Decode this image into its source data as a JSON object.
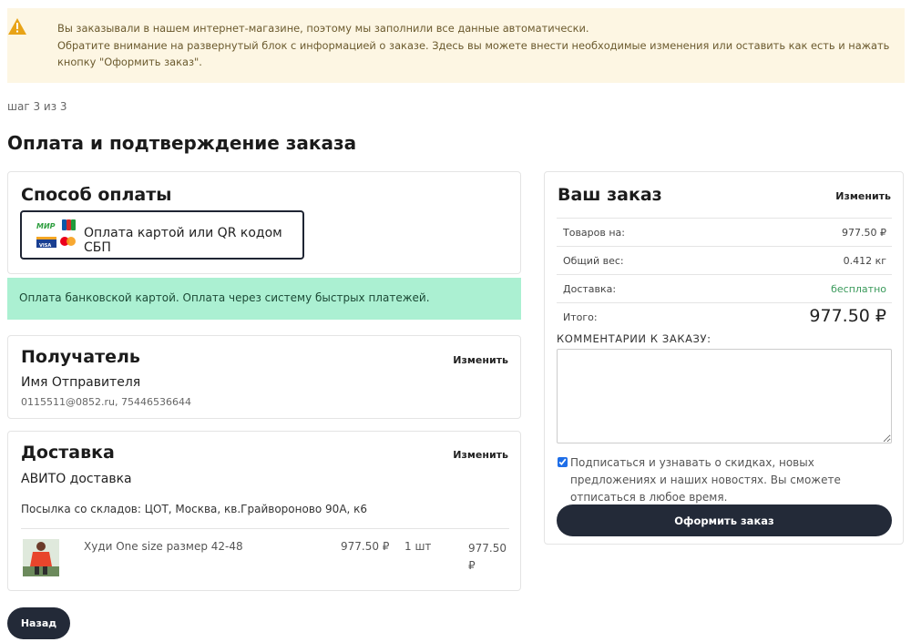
{
  "notice": {
    "icon": "warning-icon",
    "line1": "Вы заказывали в нашем интернет-магазине, поэтому мы заполнили все данные автоматически.",
    "line2": "Обратите внимание на развернутый блок с информацией о заказе. Здесь вы можете внести необходимые изменения или оставить как есть и нажать",
    "line3": "кнопку \"Оформить заказ\"."
  },
  "step": "шаг 3 из 3",
  "page_title": "Оплата и подтверждение заказа",
  "payment": {
    "title": "Способ оплаты",
    "option_label": "Оплата картой или QR кодом СБП",
    "logos": {
      "mir": "МИР",
      "visa": "VISA"
    },
    "info": "Оплата банковской картой. Оплата через систему быстрых платежей."
  },
  "recipient": {
    "title": "Получатель",
    "change": "Изменить",
    "name": "Имя Отправителя",
    "contacts": "0115511@0852.ru, 75446536644"
  },
  "delivery": {
    "title": "Доставка",
    "change": "Изменить",
    "method": "АВИТО доставка",
    "address": "Посылка со складов: ЦОТ, Москва, кв.Грайвороново 90А, к6",
    "item": {
      "name": "Худи One size размер 42-48",
      "price": "977.50 ₽",
      "qty": "1 шт",
      "total": "977.50 ₽"
    }
  },
  "back_button": "Назад",
  "summary": {
    "title": "Ваш заказ",
    "change": "Изменить",
    "rows": [
      {
        "label": "Товаров на:",
        "value": "977.50 ₽"
      },
      {
        "label": "Общий вес:",
        "value": "0.412 кг"
      },
      {
        "label": "Доставка:",
        "value": "бесплатно"
      },
      {
        "label": "Итого:",
        "value": "977.50 ₽"
      }
    ],
    "comment_label": "КОММЕНТАРИИ К ЗАКАЗУ:",
    "subscribe_text": "Подписаться и узнавать о скидках, новых предложениях и наших новостях. Вы сможете отписаться в любое время.",
    "submit": "Оформить заказ"
  },
  "colors": {
    "notice_bg": "#fdf6e3",
    "warning": "#e8a317",
    "info_bg": "#abf0d2",
    "dark_button": "#232a38",
    "free_green": "#3a9a5b"
  }
}
